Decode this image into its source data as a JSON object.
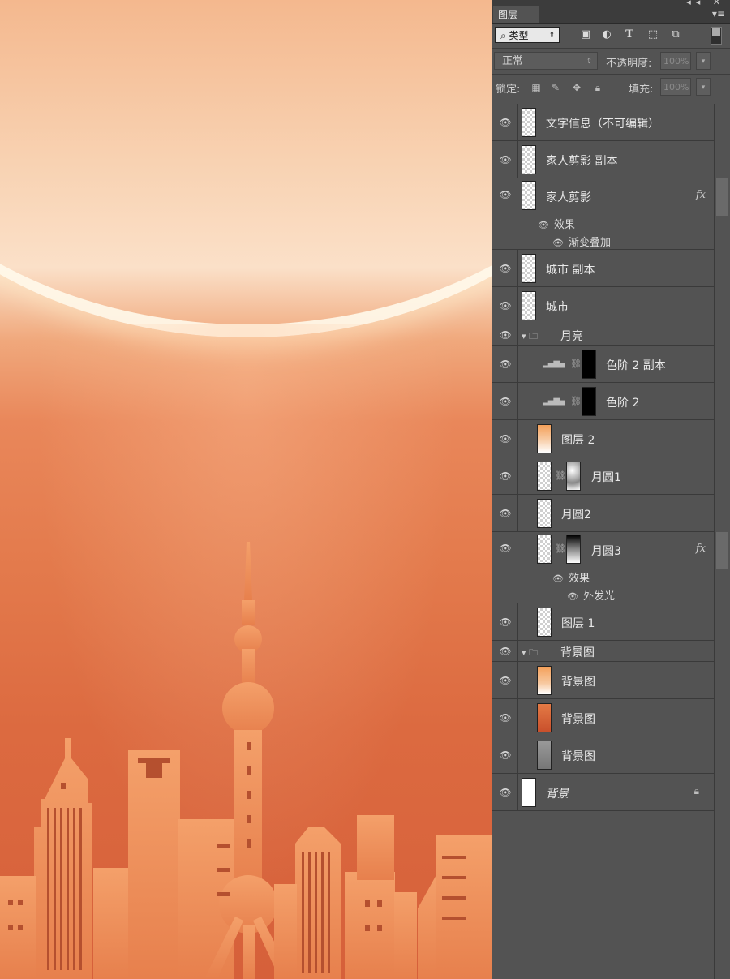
{
  "panel": {
    "tab_label": "图层",
    "window_controls": "◂◂ ✕",
    "menu_icon": "▾≡",
    "filter": {
      "label": "⌕ 类型",
      "arrow": "⇕"
    },
    "blend_mode": "正常",
    "opacity_label": "不透明度:",
    "opacity_value": "100%",
    "lock_label": "锁定:",
    "fill_label": "填充:",
    "fill_value": "100%"
  },
  "layers": [
    {
      "name": "文字信息（不可编辑）"
    },
    {
      "name": "家人剪影 副本"
    },
    {
      "name": "家人剪影",
      "fx": "fx",
      "effects_label": "效果",
      "effect": "渐变叠加"
    },
    {
      "name": "城市 副本"
    },
    {
      "name": "城市"
    },
    {
      "name": "月亮",
      "group": true
    },
    {
      "name": "色阶 2 副本"
    },
    {
      "name": "色阶 2"
    },
    {
      "name": "图层 2"
    },
    {
      "name": "月圆1"
    },
    {
      "name": "月圆2"
    },
    {
      "name": "月圆3",
      "fx": "fx",
      "effects_label": "效果",
      "effect": "外发光"
    },
    {
      "name": "图层 1"
    },
    {
      "name": "背景图",
      "group": true
    },
    {
      "name": "背景图"
    },
    {
      "name": "背景图"
    },
    {
      "name": "背景图"
    },
    {
      "name": "背景"
    }
  ],
  "colors": {
    "panel_bg": "#535353",
    "canvas_top": "#f4b88e",
    "canvas_bottom": "#d6603a",
    "city": "#f0955e"
  }
}
